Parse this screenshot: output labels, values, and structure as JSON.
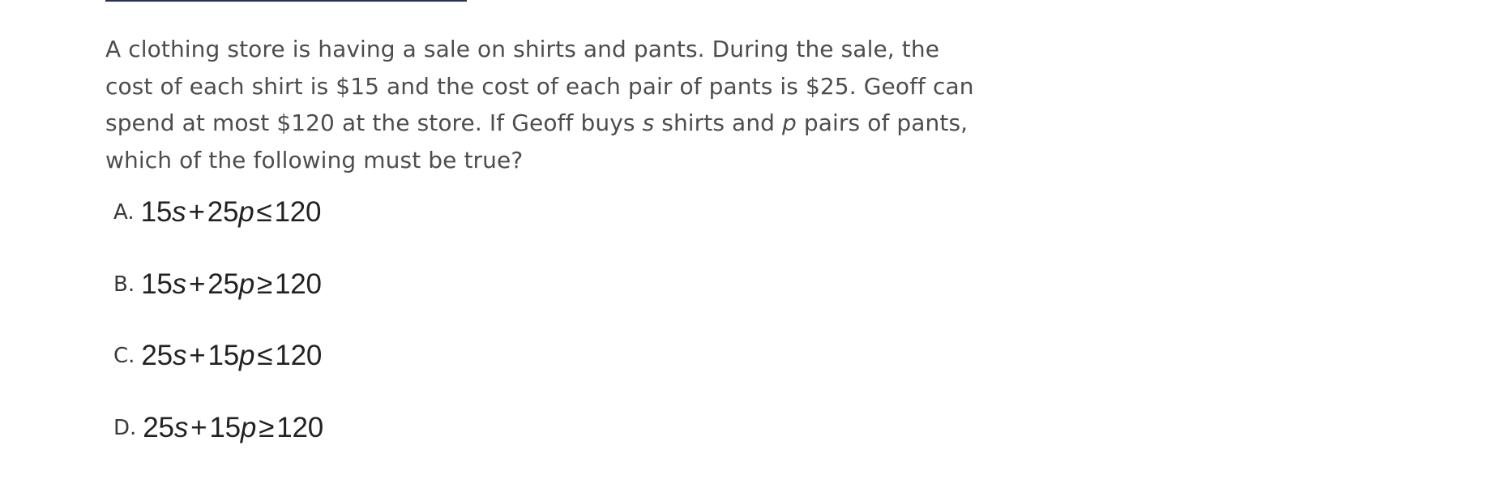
{
  "question": {
    "part1": "A clothing store is having a sale on shirts and pants. During the sale, the cost of each shirt is $15 and the cost of each pair of pants is $25. Geoff can spend at most $120 at the store. If Geoff buys ",
    "var_s": "s",
    "part2": " shirts and ",
    "var_p": "p",
    "part3": " pairs of pants, which of the following must be true?"
  },
  "choices": [
    {
      "letter": "A.",
      "coef1": "15",
      "var1": "s",
      "plus": "+",
      "coef2": "25",
      "var2": "p",
      "relation": "≤",
      "rhs": "120"
    },
    {
      "letter": "B.",
      "coef1": "15",
      "var1": "s",
      "plus": "+",
      "coef2": "25",
      "var2": "p",
      "relation": "≥",
      "rhs": "120"
    },
    {
      "letter": "C.",
      "coef1": "25",
      "var1": "s",
      "plus": "+",
      "coef2": "15",
      "var2": "p",
      "relation": "≤",
      "rhs": "120"
    },
    {
      "letter": "D.",
      "coef1": "25",
      "var1": "s",
      "plus": "+",
      "coef2": "15",
      "var2": "p",
      "relation": "≥",
      "rhs": "120"
    }
  ]
}
